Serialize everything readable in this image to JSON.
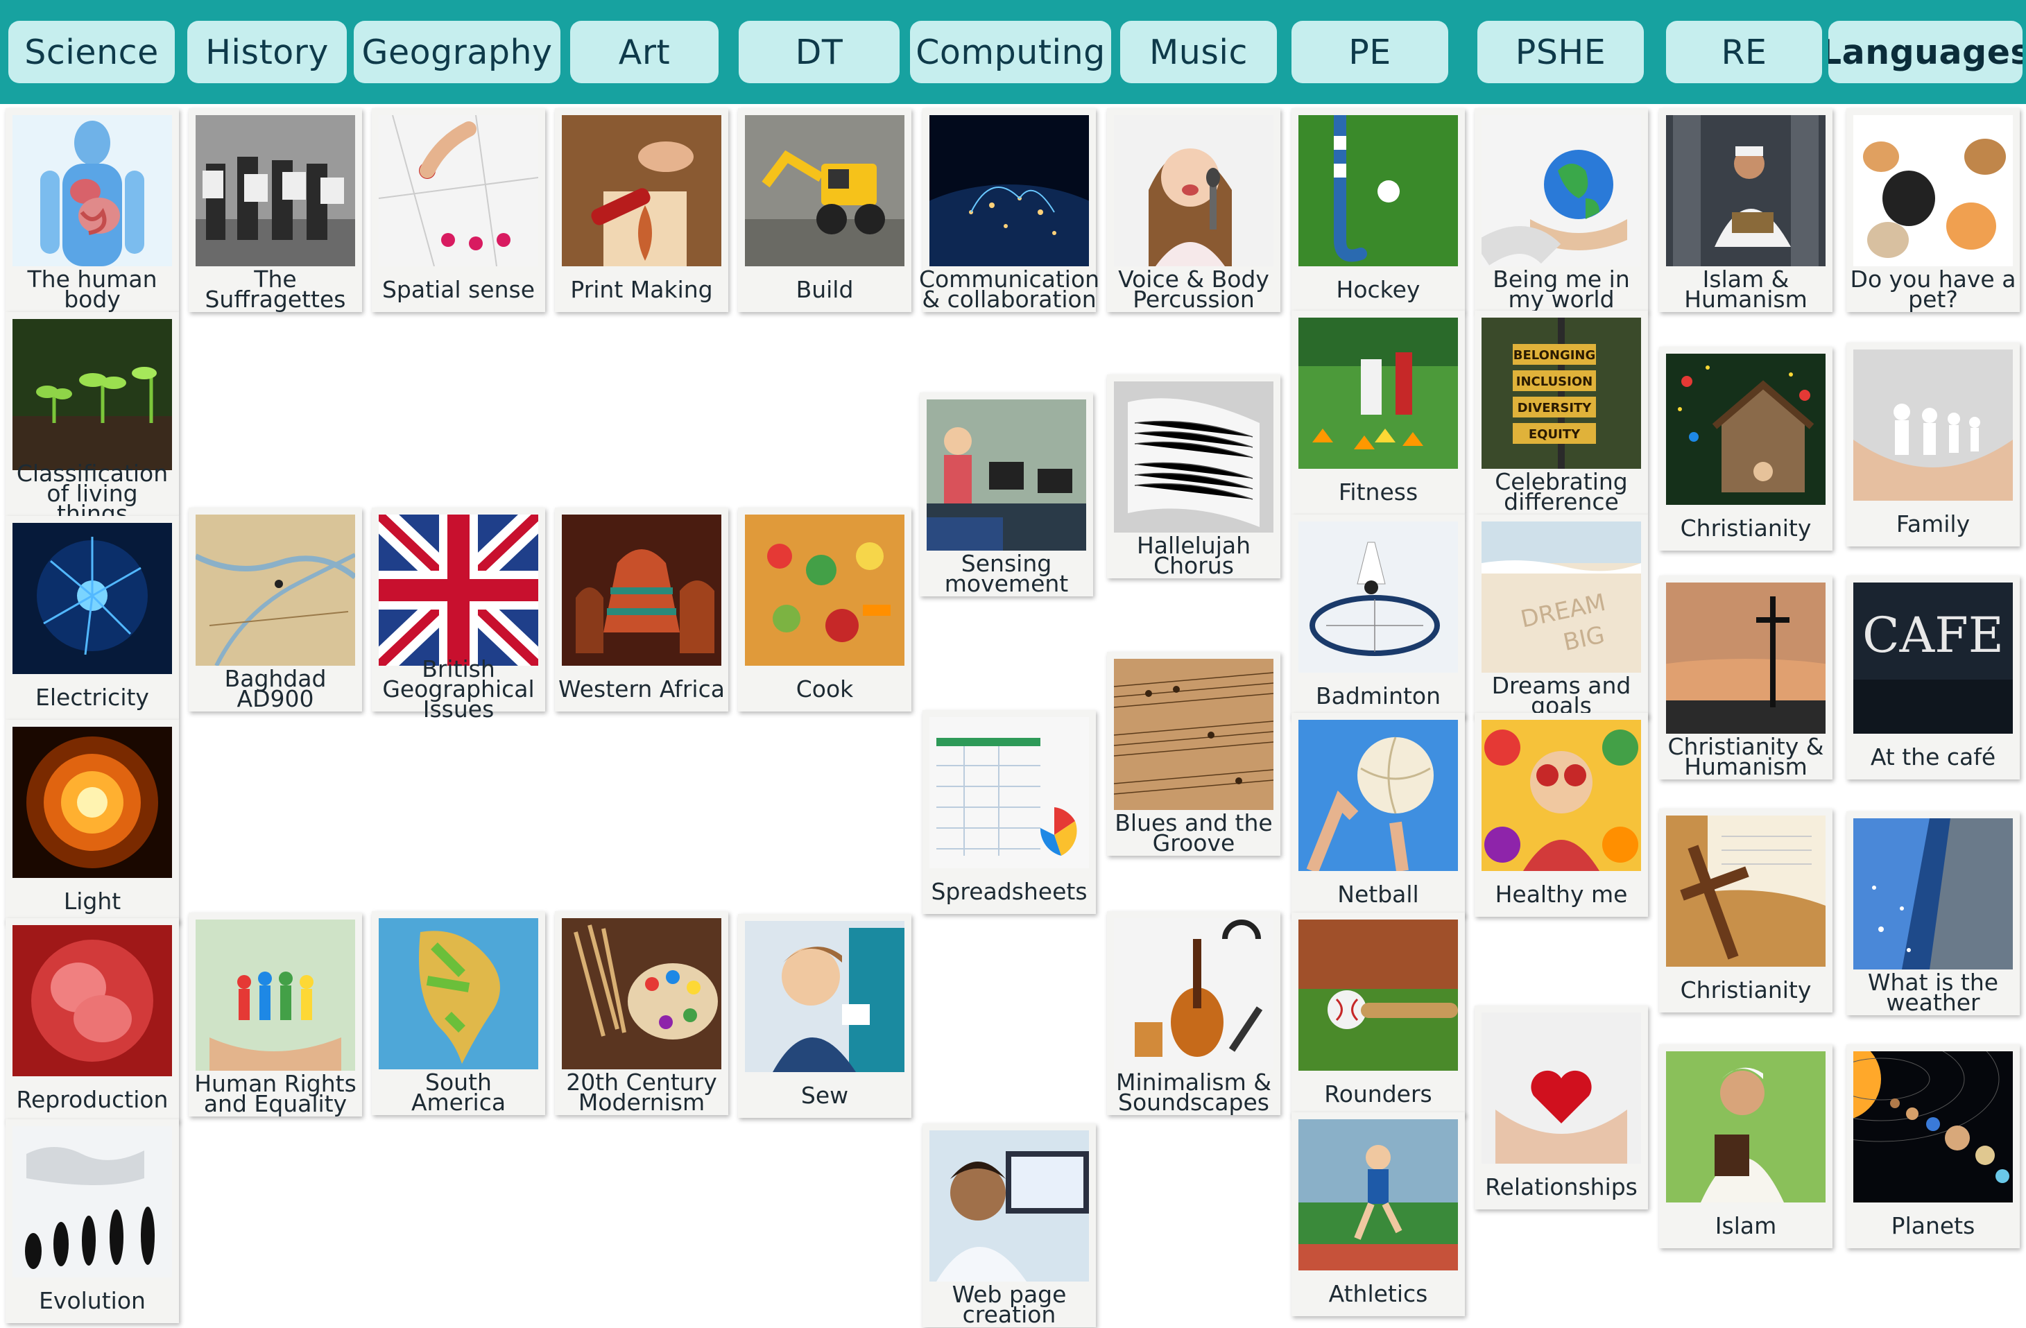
{
  "tabs": [
    {
      "label": "Science"
    },
    {
      "label": "History"
    },
    {
      "label": "Geography"
    },
    {
      "label": "Art"
    },
    {
      "label": "DT"
    },
    {
      "label": "Computing"
    },
    {
      "label": "Music"
    },
    {
      "label": "PE"
    },
    {
      "label": "PSHE"
    },
    {
      "label": "RE"
    },
    {
      "label": "Languages"
    }
  ],
  "topics": {
    "science": [
      {
        "label": "The human body",
        "icon": "human-body-icon"
      },
      {
        "label": "Classification of living things",
        "icon": "seedlings-icon"
      },
      {
        "label": "Electricity",
        "icon": "plasma-ball-icon"
      },
      {
        "label": "Light",
        "icon": "light-burst-icon"
      },
      {
        "label": "Reproduction",
        "icon": "fetus-icon"
      },
      {
        "label": "Evolution",
        "icon": "evolution-icon"
      }
    ],
    "history": [
      {
        "label": "The Suffragettes",
        "icon": "suffragettes-icon"
      },
      {
        "label": "Baghdad AD900",
        "icon": "map-icon"
      },
      {
        "label": "Human Rights and Equality",
        "icon": "paper-people-icon"
      }
    ],
    "geography": [
      {
        "label": "Spatial sense",
        "icon": "pins-icon"
      },
      {
        "label": "British Geographical Issues",
        "icon": "union-flag-icon"
      },
      {
        "label": "South America",
        "icon": "globe-icon"
      }
    ],
    "art": [
      {
        "label": "Print Making",
        "icon": "print-roller-icon"
      },
      {
        "label": "Western Africa",
        "icon": "baskets-icon"
      },
      {
        "label": "20th Century Modernism",
        "icon": "palette-icon"
      }
    ],
    "dt": [
      {
        "label": "Build",
        "icon": "digger-icon"
      },
      {
        "label": "Cook",
        "icon": "vegetables-icon"
      },
      {
        "label": "Sew",
        "icon": "child-sewing-icon"
      }
    ],
    "computing": [
      {
        "label": "Communication & collaboration",
        "icon": "network-globe-icon"
      },
      {
        "label": "Sensing movement",
        "icon": "classroom-icon"
      },
      {
        "label": "Spreadsheets",
        "icon": "spreadsheet-icon"
      },
      {
        "label": "Web page creation",
        "icon": "computer-user-icon"
      }
    ],
    "music": [
      {
        "label": "Voice & Body Percussion",
        "icon": "singer-icon"
      },
      {
        "label": "Hallelujah Chorus",
        "icon": "sheet-music-icon"
      },
      {
        "label": "Blues and the Groove",
        "icon": "score-icon"
      },
      {
        "label": "Minimalism & Soundscapes",
        "icon": "instruments-icon"
      }
    ],
    "pe": [
      {
        "label": "Hockey",
        "icon": "hockey-stick-icon"
      },
      {
        "label": "Fitness",
        "icon": "cones-icon"
      },
      {
        "label": "Badminton",
        "icon": "shuttlecock-icon"
      },
      {
        "label": "Netball",
        "icon": "ball-icon"
      },
      {
        "label": "Rounders",
        "icon": "bat-ball-icon"
      },
      {
        "label": "Athletics",
        "icon": "runner-icon"
      }
    ],
    "pshe": [
      {
        "label": "Being me in my world",
        "icon": "earth-hands-icon"
      },
      {
        "label": "Celebrating difference",
        "icon": "signpost-icon",
        "words": [
          "BELONGING",
          "INCLUSION",
          "DIVERSITY",
          "EQUITY"
        ]
      },
      {
        "label": "Dreams and goals",
        "icon": "sand-writing-icon",
        "words": [
          "DREAM",
          "BIG"
        ]
      },
      {
        "label": "Healthy me",
        "icon": "fruit-icon"
      },
      {
        "label": "Relationships",
        "icon": "heart-hands-icon"
      }
    ],
    "re": [
      {
        "label": "Islam & Humanism",
        "icon": "reader-icon"
      },
      {
        "label": "Christianity",
        "icon": "nativity-icon"
      },
      {
        "label": "Christianity & Humanism",
        "icon": "crucifix-icon"
      },
      {
        "label": "Christianity",
        "icon": "cross-book-icon"
      },
      {
        "label": "Islam",
        "icon": "boy-quran-icon"
      }
    ],
    "languages": [
      {
        "label": "Do you have a pet?",
        "icon": "pets-icon"
      },
      {
        "label": "Family",
        "icon": "paper-family-icon"
      },
      {
        "label": "At the café",
        "icon": "cafe-sign-icon",
        "words": [
          "CAFE"
        ]
      },
      {
        "label": "What is the weather",
        "icon": "sky-icon"
      },
      {
        "label": "Planets",
        "icon": "planets-icon"
      }
    ]
  }
}
